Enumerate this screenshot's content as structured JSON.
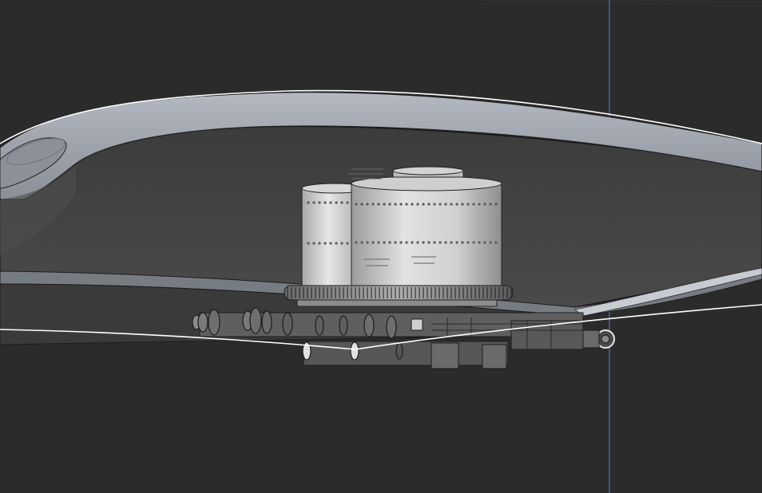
{
  "viewport": {
    "background": "#2b2b2b",
    "selection_color": "#ffffff",
    "axis_line_color": "#5d6fb5",
    "wing_color": "#9a9ea6",
    "engine_color": "#c8c8c8"
  },
  "icons": {
    "engine": "radial-engine-model",
    "wing": "wing-model",
    "axis": "vertical-axis-line"
  }
}
